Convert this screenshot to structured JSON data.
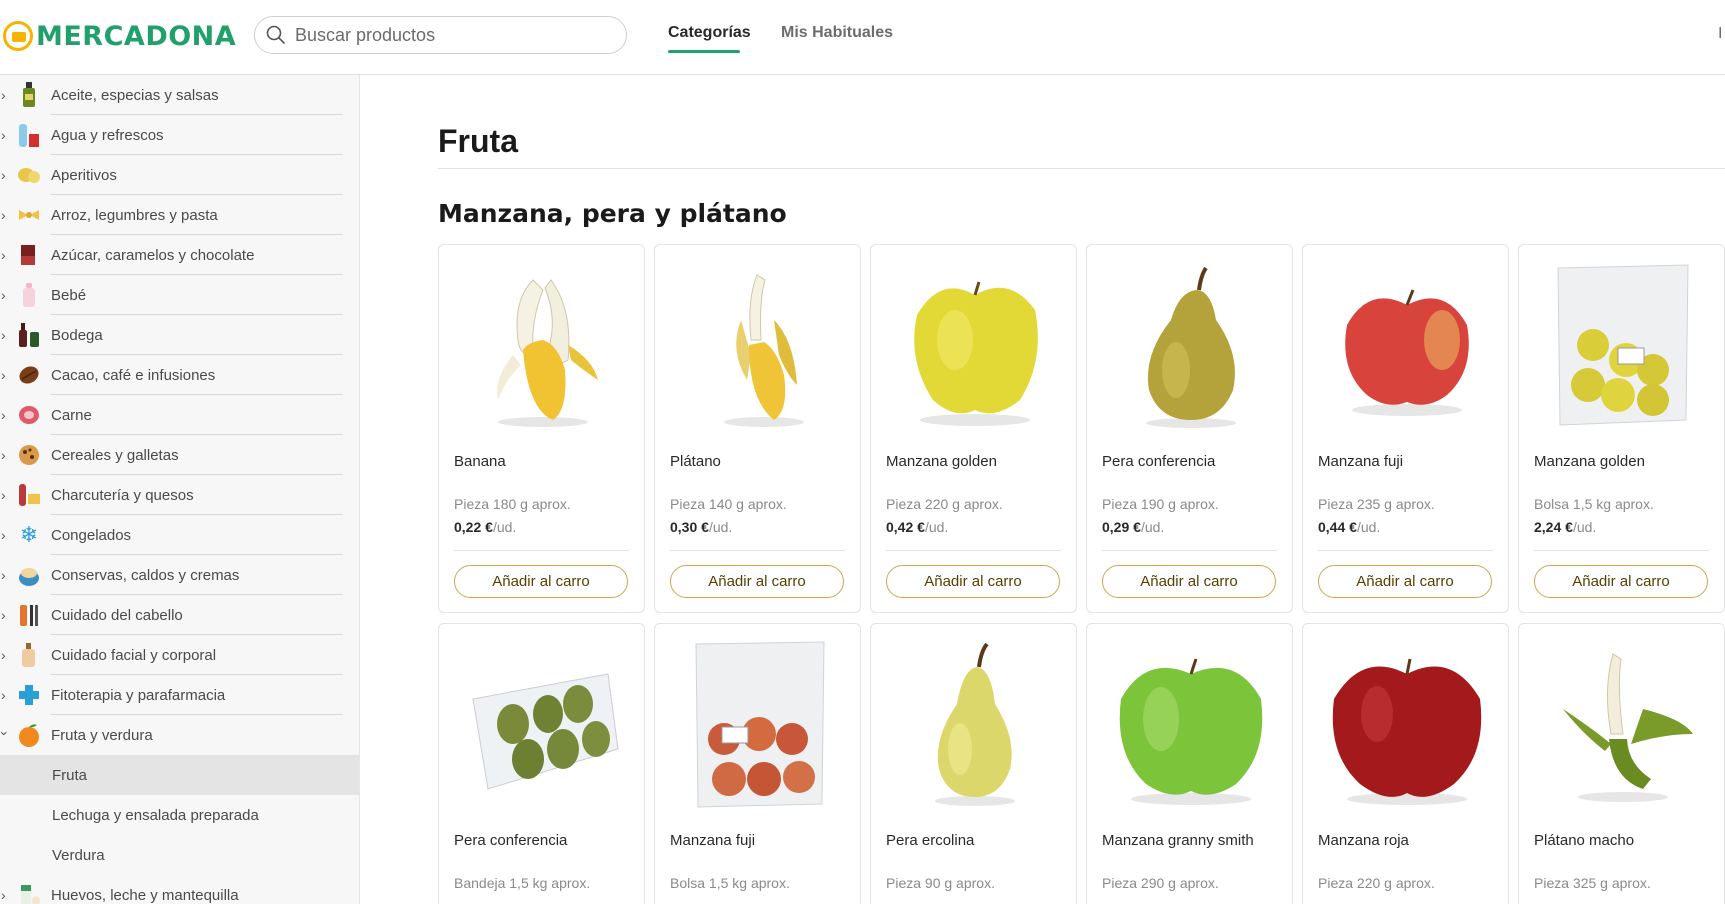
{
  "header": {
    "logo_text": "MERCADONA",
    "search_placeholder": "Buscar productos",
    "tabs": [
      {
        "label": "Categorías"
      },
      {
        "label": "Mis Habituales"
      }
    ],
    "edge_text": "I"
  },
  "sidebar": {
    "categories_top": [
      {
        "label": "Aceite, especias y salsas",
        "icon": "oil-bottle-icon"
      },
      {
        "label": "Agua y refrescos",
        "icon": "water-bottle-icon"
      },
      {
        "label": "Aperitivos",
        "icon": "snack-icon"
      },
      {
        "label": "Arroz, legumbres y pasta",
        "icon": "pasta-icon"
      },
      {
        "label": "Azúcar, caramelos y chocolate",
        "icon": "chocolate-icon"
      },
      {
        "label": "Bebé",
        "icon": "baby-bottle-icon"
      },
      {
        "label": "Bodega",
        "icon": "wine-icon"
      },
      {
        "label": "Cacao, café e infusiones",
        "icon": "coffee-bean-icon"
      },
      {
        "label": "Carne",
        "icon": "meat-icon"
      },
      {
        "label": "Cereales y galletas",
        "icon": "cookie-icon"
      },
      {
        "label": "Charcutería y quesos",
        "icon": "cheese-icon"
      },
      {
        "label": "Congelados",
        "icon": "snowflake-icon"
      },
      {
        "label": "Conservas, caldos y cremas",
        "icon": "can-icon"
      },
      {
        "label": "Cuidado del cabello",
        "icon": "comb-icon"
      },
      {
        "label": "Cuidado facial y corporal",
        "icon": "cream-icon"
      },
      {
        "label": "Fitoterapia y parafarmacia",
        "icon": "cross-icon"
      },
      {
        "label": "Fruta y verdura",
        "icon": "orange-icon"
      }
    ],
    "subcategories": [
      {
        "label": "Fruta",
        "active": true
      },
      {
        "label": "Lechuga y ensalada preparada",
        "active": false
      },
      {
        "label": "Verdura",
        "active": false
      }
    ],
    "categories_bottom": [
      {
        "label": "Huevos, leche y mantequilla",
        "icon": "milk-icon"
      }
    ]
  },
  "main": {
    "title": "Fruta",
    "section_title": "Manzana, pera y plátano",
    "add_label": "Añadir al carro",
    "products": [
      {
        "name": "Banana",
        "format": "Pieza 180 g aprox.",
        "price": "0,22 €",
        "unit": "/ud.",
        "image": "banana-image"
      },
      {
        "name": "Plátano",
        "format": "Pieza 140 g aprox.",
        "price": "0,30 €",
        "unit": "/ud.",
        "image": "platano-image"
      },
      {
        "name": "Manzana golden",
        "format": "Pieza 220 g aprox.",
        "price": "0,42 €",
        "unit": "/ud.",
        "image": "golden-apple-image"
      },
      {
        "name": "Pera conferencia",
        "format": "Pieza 190 g aprox.",
        "price": "0,29 €",
        "unit": "/ud.",
        "image": "pear-image"
      },
      {
        "name": "Manzana fuji",
        "format": "Pieza 235 g aprox.",
        "price": "0,44 €",
        "unit": "/ud.",
        "image": "fuji-apple-image"
      },
      {
        "name": "Manzana golden",
        "format": "Bolsa 1,5 kg aprox.",
        "price": "2,24 €",
        "unit": "/ud.",
        "image": "golden-apple-bag-image"
      },
      {
        "name": "Pera conferencia",
        "format": "Bandeja 1,5 kg aprox.",
        "price": "",
        "unit": "",
        "image": "pear-tray-image"
      },
      {
        "name": "Manzana fuji",
        "format": "Bolsa 1,5 kg aprox.",
        "price": "",
        "unit": "",
        "image": "fuji-apple-bag-image"
      },
      {
        "name": "Pera ercolina",
        "format": "Pieza 90 g aprox.",
        "price": "",
        "unit": "",
        "image": "ercolina-pear-image"
      },
      {
        "name": "Manzana granny smith",
        "format": "Pieza 290 g aprox.",
        "price": "",
        "unit": "",
        "image": "granny-smith-image"
      },
      {
        "name": "Manzana roja",
        "format": "Pieza 220 g aprox.",
        "price": "",
        "unit": "",
        "image": "red-apple-image"
      },
      {
        "name": "Plátano macho",
        "format": "Pieza 325 g aprox.",
        "price": "",
        "unit": "",
        "image": "platano-macho-image"
      }
    ]
  },
  "colors": {
    "brand_green": "#21a06b",
    "logo_yellow": "#f6b400",
    "button_border": "#d7a34a"
  }
}
